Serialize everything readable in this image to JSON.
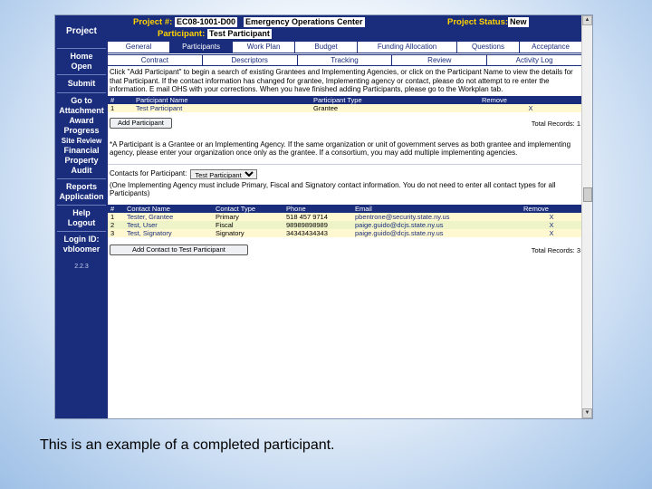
{
  "sidebar": {
    "project_label": "Project",
    "items": [
      {
        "label": "Home"
      },
      {
        "label": "Open"
      },
      {
        "label": "Submit"
      },
      {
        "label": "Go to"
      },
      {
        "label": "Attachment"
      },
      {
        "label": "Award"
      },
      {
        "label": "Progress"
      },
      {
        "label": "Site Review"
      },
      {
        "label": "Financial"
      },
      {
        "label": "Property"
      },
      {
        "label": "Audit"
      },
      {
        "label": "Reports"
      },
      {
        "label": "Application"
      },
      {
        "label": "Help"
      },
      {
        "label": "Logout"
      }
    ],
    "login_label": "Login ID:",
    "login_value": "vbloomer",
    "version": "2.2.3"
  },
  "header": {
    "project_num_label": "Project #:",
    "project_num": "EC08-1001-D00",
    "project_name": "Emergency Operations Center",
    "status_label": "Project Status:",
    "status_value": "New",
    "participant_label": "Participant:",
    "participant_value": "Test Participant"
  },
  "tabs_row1": [
    {
      "label": "General"
    },
    {
      "label": "Participants"
    },
    {
      "label": "Work Plan"
    },
    {
      "label": "Budget"
    },
    {
      "label": "Funding Allocation"
    },
    {
      "label": "Questions"
    },
    {
      "label": "Acceptance"
    }
  ],
  "tabs_row2": [
    {
      "label": "Contract"
    },
    {
      "label": "Descriptors"
    },
    {
      "label": "Tracking"
    },
    {
      "label": "Review"
    },
    {
      "label": "Activity Log"
    }
  ],
  "instructions": "Click \"Add Participant\" to begin a search of existing Grantees and Implementing Agencies, or click on the Participant Name to view the details for that Participant. If the contact information has changed for grantee, Implementing agency or contact, please do not attempt to re enter the information. E mail OHS with your corrections. When you have finished adding Participants, please go to the Workplan tab.",
  "participants_table": {
    "headers": [
      "#",
      "Participant Name",
      "Participant Type",
      "Remove"
    ],
    "rows": [
      [
        "1",
        "Test Participant",
        "Grantee",
        "X"
      ]
    ]
  },
  "add_participant_label": "Add Participant",
  "participants_total": "Total Records: 1",
  "note": "*A Participant is a Grantee or an Implementing Agency. If the same organization or unit of government serves as both grantee and implementing agency, please enter your organization once only as the grantee. If a consortium, you may add multiple implementing agencies.",
  "contacts_for_label": "Contacts for Participant:",
  "contacts_select": "Test Participant",
  "contacts_note": "(One Implementing Agency must include Primary, Fiscal and Signatory contact information. You do not need to enter all contact types for all Participants)",
  "contacts_table": {
    "headers": [
      "#",
      "Contact Name",
      "Contact Type",
      "Phone",
      "Email",
      "Remove"
    ],
    "rows": [
      [
        "1",
        "Tester, Grantee",
        "Primary",
        "518 457 9714",
        "pbentrone@security.state.ny.us",
        "X"
      ],
      [
        "2",
        "Test, User",
        "Fiscal",
        "98989898989",
        "paige.guido@dcjs.state.ny.us",
        "X"
      ],
      [
        "3",
        "Test, Signatory",
        "Signatory",
        "34343434343",
        "paige.guido@dcjs.state.ny.us",
        "X"
      ]
    ]
  },
  "add_contact_label": "Add Contact to Test Participant",
  "contacts_total": "Total Records: 3",
  "caption": "This is an example of a completed participant.",
  "colors": {
    "nav_bg": "#1a2d7c",
    "header_label": "#ffd200",
    "row_highlight": "#fff8d0"
  }
}
